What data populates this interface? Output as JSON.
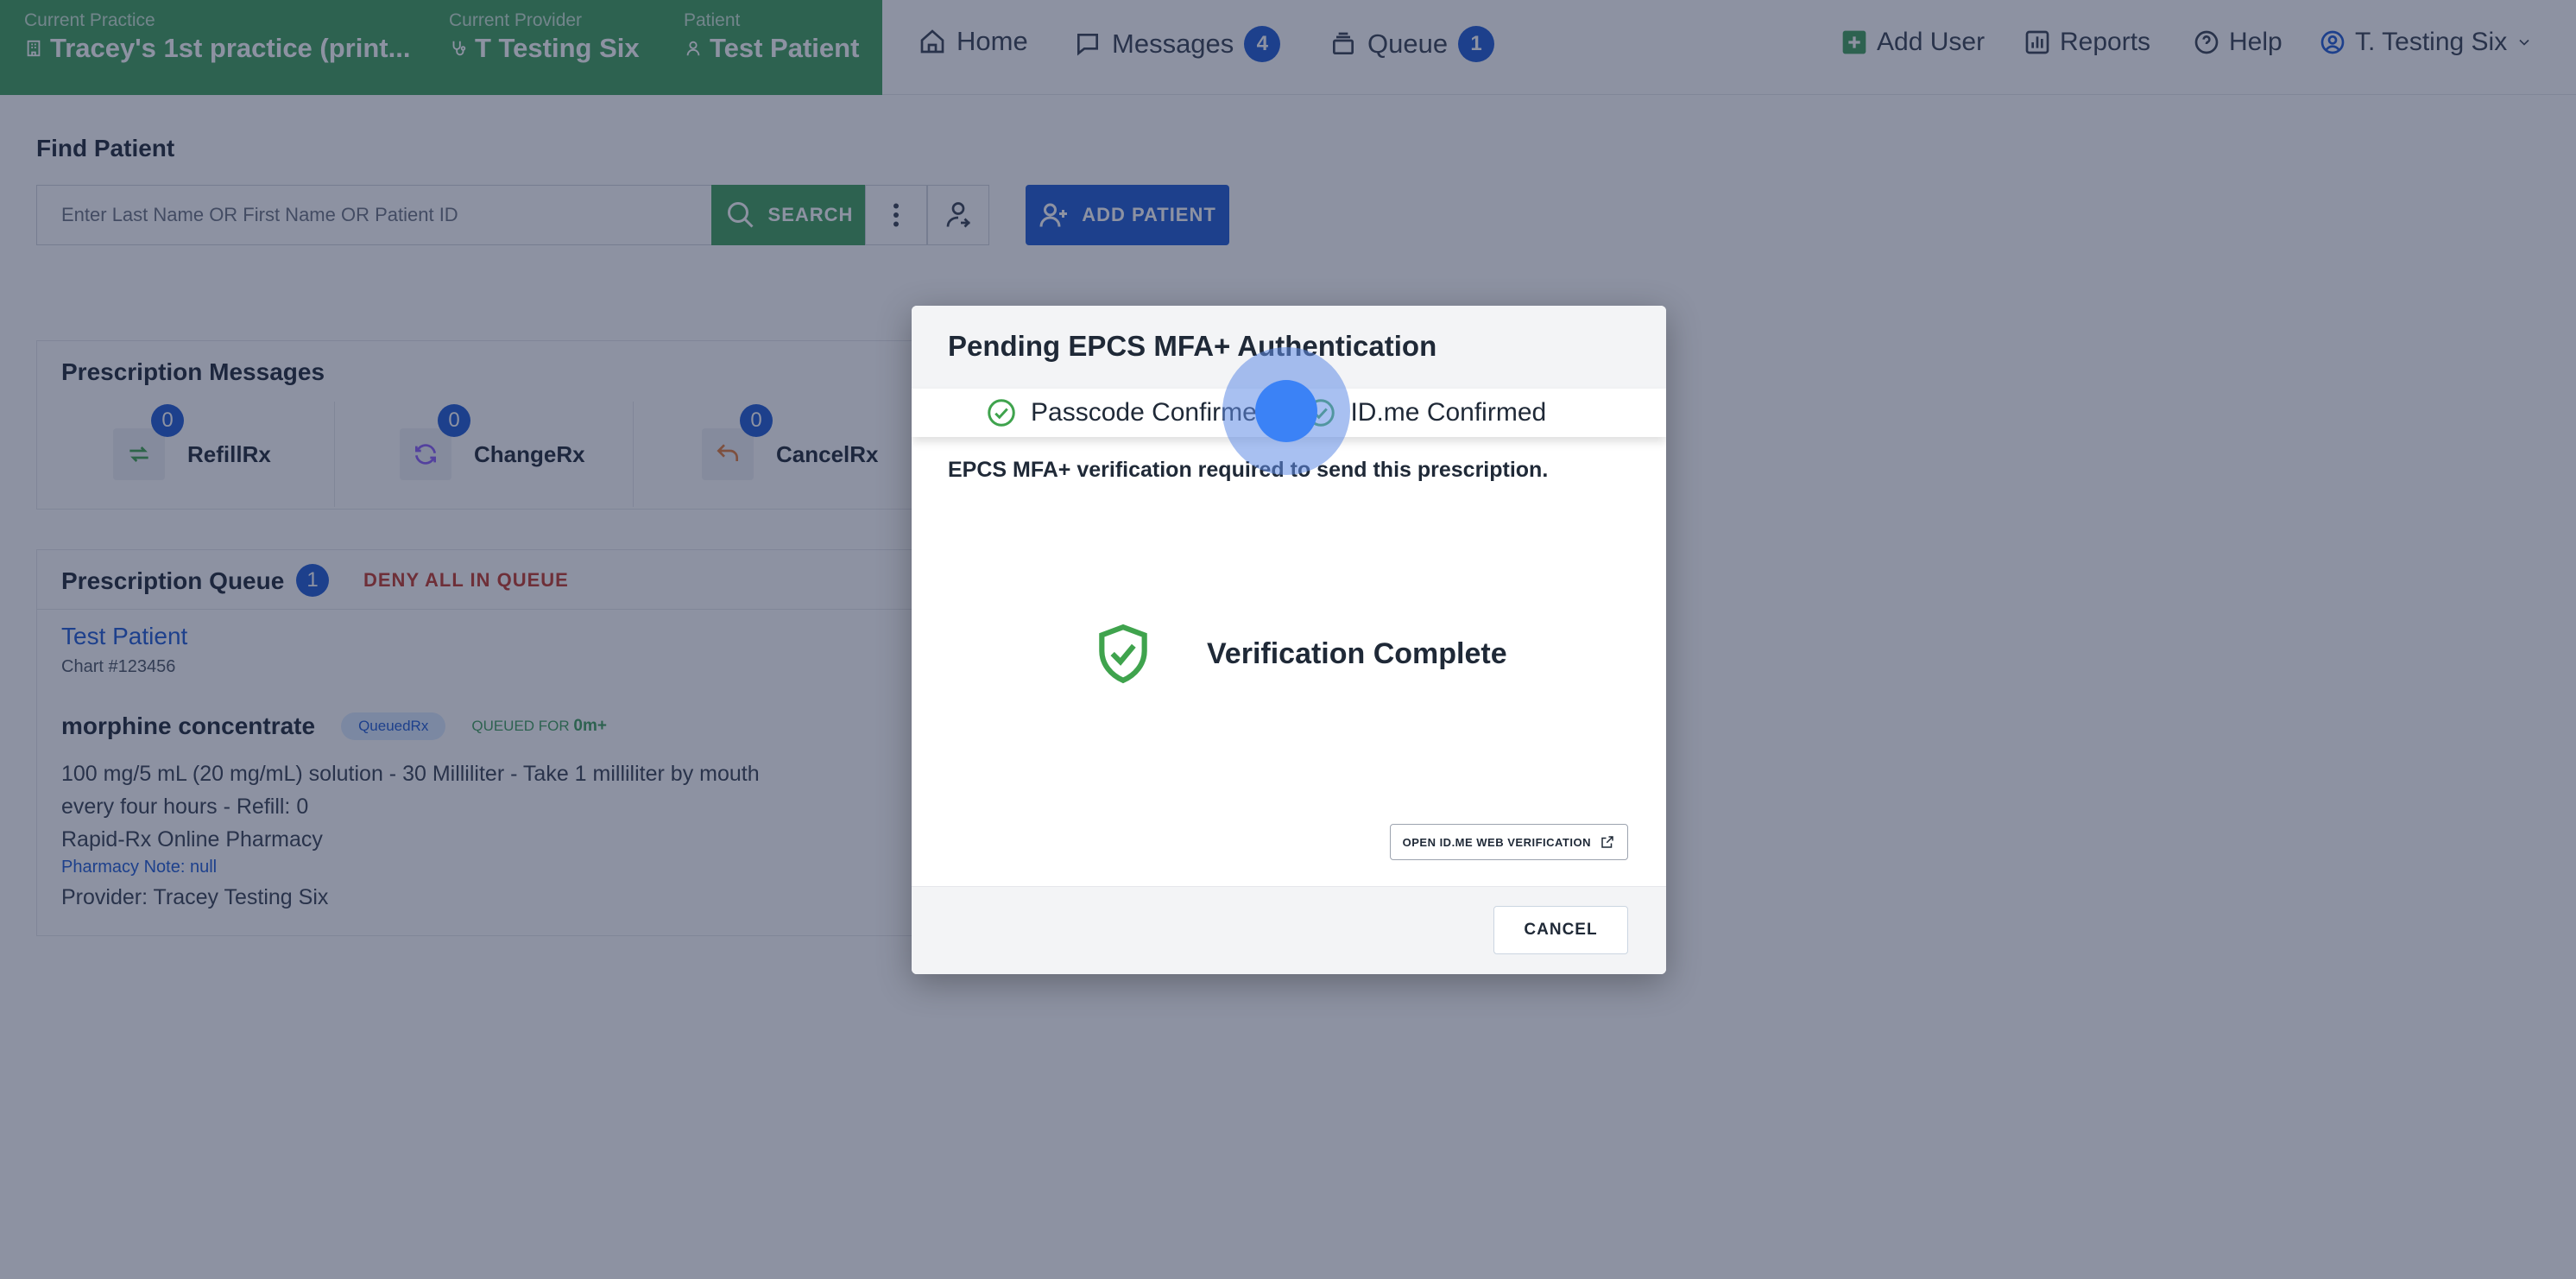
{
  "context": {
    "practice_label": "Current Practice",
    "practice_value": "Tracey's 1st practice (print...",
    "provider_label": "Current Provider",
    "provider_value": "T Testing Six",
    "patient_label": "Patient",
    "patient_value": "Test Patient"
  },
  "nav": {
    "home": "Home",
    "messages": "Messages",
    "messages_count": "4",
    "queue": "Queue",
    "queue_count": "1",
    "add_user": "Add User",
    "reports": "Reports",
    "help": "Help",
    "user": "T. Testing Six"
  },
  "find_patient": {
    "title": "Find Patient",
    "placeholder": "Enter Last Name OR First Name OR Patient ID",
    "search_label": "SEARCH",
    "add_patient_label": "ADD PATIENT"
  },
  "prescription_messages": {
    "title": "Prescription Messages",
    "items": [
      {
        "name": "RefillRx",
        "count": "0"
      },
      {
        "name": "ChangeRx",
        "count": "0"
      },
      {
        "name": "CancelRx",
        "count": "0"
      }
    ]
  },
  "prescription_queue": {
    "title": "Prescription Queue",
    "count": "1",
    "deny_all": "DENY ALL IN QUEUE",
    "patient_name": "Test Patient",
    "chart": "Chart #123456",
    "drug": "morphine concentrate",
    "status_tag": "QueuedRx",
    "queued_for_label": "QUEUED FOR",
    "queued_for_value": "0m+",
    "sig_line1": "100 mg/5 mL (20 mg/mL) solution - 30 Milliliter - Take 1 milliliter by mouth",
    "sig_line2": "every four hours - Refill: 0",
    "pharmacy": "Rapid-Rx Online Pharmacy",
    "pharmacy_note": "Pharmacy Note: null",
    "provider": "Provider: Tracey Testing Six"
  },
  "modal": {
    "title": "Pending EPCS MFA+ Authentication",
    "step1": "Passcode Confirmed",
    "step2": "ID.me Confirmed",
    "instruction": "EPCS MFA+ verification required to send this prescription.",
    "status": "Verification Complete",
    "idme_button": "OPEN ID.ME WEB VERIFICATION",
    "cancel_button": "CANCEL"
  },
  "colors": {
    "brand_green": "#3f9f5a",
    "primary_blue": "#1e5ad2",
    "danger_red": "#c0392b",
    "success_green": "#3fa34d"
  }
}
